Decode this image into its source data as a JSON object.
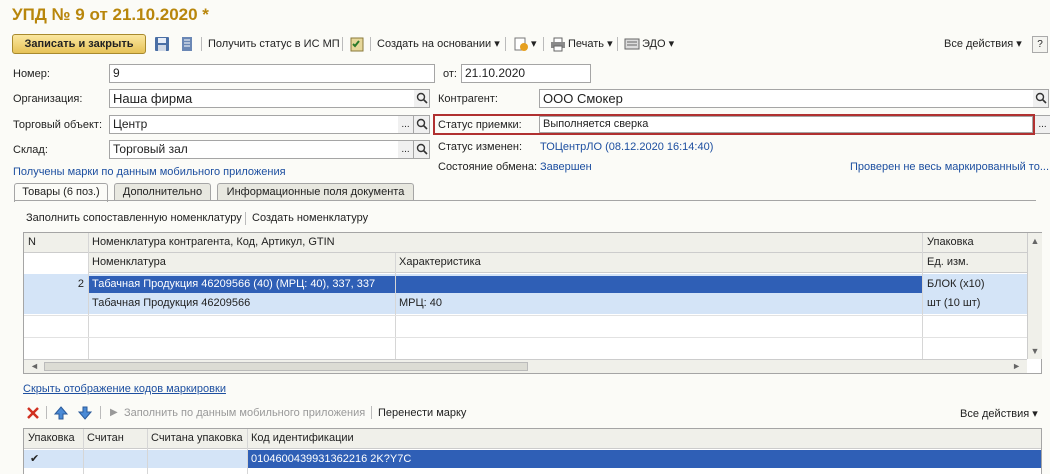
{
  "window": {
    "title": "УПД № 9 от 21.10.2020 *"
  },
  "toolbar": {
    "save_close": "Записать и закрыть",
    "get_status": "Получить статус в ИС МП",
    "create_based": "Создать на основании",
    "print": "Печать",
    "edo": "ЭДО",
    "all_actions": "Все действия"
  },
  "form": {
    "number_label": "Номер:",
    "number_value": "9",
    "date_label": "от:",
    "date_value": "21.10.2020",
    "org_label": "Организация:",
    "org_value": "Наша фирма",
    "counterparty_label": "Контрагент:",
    "counterparty_value": "ООО Смокер",
    "trade_object_label": "Торговый объект:",
    "trade_object_value": "Центр",
    "accept_status_label": "Статус приемки:",
    "accept_status_value": "Выполняется сверка",
    "warehouse_label": "Склад:",
    "warehouse_value": "Торговый зал",
    "status_changed_label": "Статус изменен:",
    "status_changed_value": "ТОЦентрЛО (08.12.2020 16:14:40)",
    "mobile_marks_link": "Получены марки по данным мобильного приложения",
    "exchange_label": "Состояние обмена:",
    "exchange_value": "Завершен",
    "checked_link": "Проверен не весь маркированный то..."
  },
  "tabs": [
    {
      "label": "Товары (6 поз.)"
    },
    {
      "label": "Дополнительно"
    },
    {
      "label": "Информационные поля документа"
    }
  ],
  "goods": {
    "fill_matched": "Заполнить сопоставленную номенклатуру",
    "create_nomenclature": "Создать номенклатуру",
    "headers": {
      "n": "N",
      "nom_cp": "Номенклатура контрагента, Код, Артикул, GTIN",
      "package": "Упаковка",
      "nom": "Номенклатура",
      "characteristic": "Характеристика",
      "unit": "Ед. изм."
    },
    "row": {
      "n": "2",
      "nom_cp": "Табачная Продукция 46209566 (40) (МРЦ: 40), 337, 337",
      "package": "БЛОК (x10)",
      "nom": "Табачная Продукция 46209566",
      "characteristic": "МРЦ: 40",
      "unit": "шт (10 шт)"
    }
  },
  "codes": {
    "hide_link": "Скрыть отображение кодов маркировки",
    "fill_mobile": "Заполнить по данным мобильного приложения",
    "move_mark": "Перенести марку",
    "all_actions": "Все действия",
    "headers": {
      "package": "Упаковка",
      "scanned": "Считан",
      "scanned_package": "Считана упаковка",
      "id_code": "Код идентификации"
    },
    "row": {
      "check": "✔",
      "id_code": "0104600439931362216 2K?Y7C"
    }
  },
  "colors": {
    "title": "#b8860b",
    "link": "#1d4fa0",
    "selected_row": "#2f5fb6",
    "light_row": "#d4e4f7"
  }
}
